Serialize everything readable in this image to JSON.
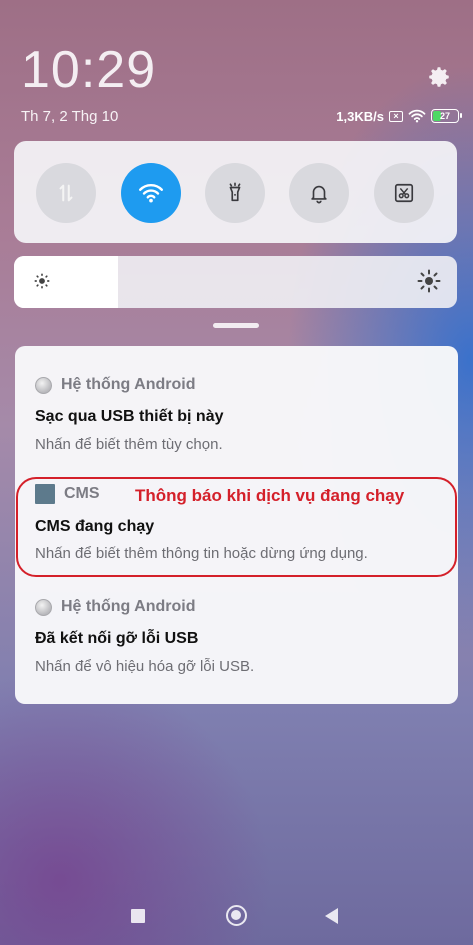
{
  "status_bar": {
    "time": "10:29",
    "date": "Th 7, 2 Thg 10",
    "network_speed": "1,3KB/s",
    "battery_level": "27"
  },
  "quick_toggles": [
    {
      "icon": "data-transfer-icon",
      "active": false
    },
    {
      "icon": "wifi-icon",
      "active": true
    },
    {
      "icon": "flashlight-icon",
      "active": false
    },
    {
      "icon": "bell-icon",
      "active": false
    },
    {
      "icon": "screenshot-scissors-icon",
      "active": false
    }
  ],
  "brightness": {
    "level": 0.235
  },
  "notifications": [
    {
      "app": "Hệ thống Android",
      "icon": "android-system-icon",
      "title": "Sạc qua USB thiết bị này",
      "text": "Nhấn để biết thêm tùy chọn."
    },
    {
      "app": "CMS",
      "icon": "cms-app-icon",
      "title": "CMS đang chạy",
      "text": "Nhấn để biết thêm thông tin hoặc dừng ứng dụng."
    },
    {
      "app": "Hệ thống Android",
      "icon": "android-system-icon",
      "title": "Đã kết nối gỡ lỗi USB",
      "text": "Nhấn để vô hiệu hóa gỡ lỗi USB."
    }
  ],
  "annotation": {
    "text": "Thông báo khi dịch vụ đang chạy",
    "color": "#d4202a"
  },
  "colors": {
    "accent": "#1e9bf0"
  }
}
